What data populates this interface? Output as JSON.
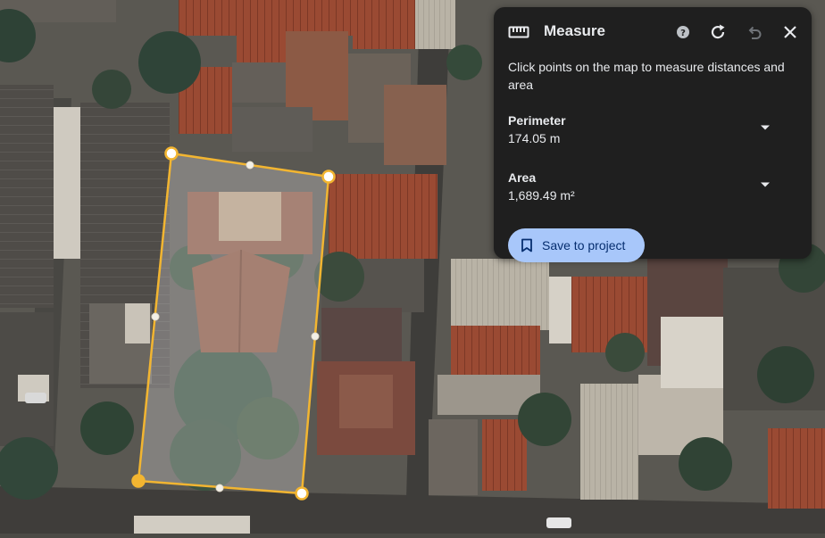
{
  "panel": {
    "title": "Measure",
    "instructions": "Click points on the map to measure distances and area",
    "perimeter": {
      "label": "Perimeter",
      "value": "174.05 m"
    },
    "area": {
      "label": "Area",
      "value": "1,689.49 m²"
    },
    "save_label": "Save to project",
    "icons": {
      "ruler": "ruler-icon",
      "help": "help-icon",
      "reset": "refresh-icon",
      "undo": "undo-icon",
      "close": "close-icon",
      "dropdown": "caret-down-icon",
      "bookmark": "bookmark-icon"
    }
  },
  "map": {
    "view": "satellite",
    "polygon_color": "#f2b531",
    "button_color": "#a8c7fa",
    "panel_color": "#1f1f1f"
  }
}
